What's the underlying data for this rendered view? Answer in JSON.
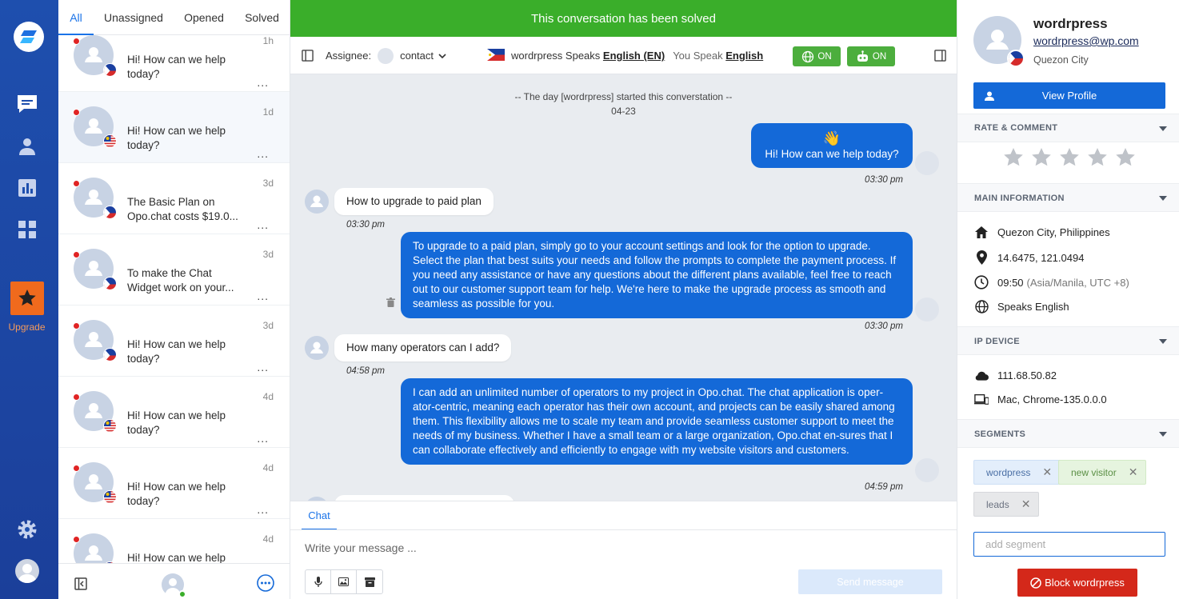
{
  "nav": {
    "upgrade_label": "Upgrade",
    "colors": {
      "background": "#1e4fae",
      "upgrade": "#f06a1d"
    }
  },
  "conversation_list": {
    "tabs": [
      {
        "label": "All",
        "active": true
      },
      {
        "label": "Unassigned"
      },
      {
        "label": "Opened"
      },
      {
        "label": "Solved"
      }
    ],
    "items": [
      {
        "time": "1h",
        "preview": "Hi! How can we help today?",
        "flag": "ph",
        "unread": true
      },
      {
        "time": "1d",
        "preview": "Hi! How can we help today?",
        "flag": "my",
        "unread": true,
        "selected": true
      },
      {
        "time": "3d",
        "preview": "The Basic Plan on Opo.chat costs $19.0...",
        "flag": "ph",
        "unread": true
      },
      {
        "time": "3d",
        "preview": "To make the Chat Widget work on your...",
        "flag": "ph",
        "unread": true
      },
      {
        "time": "3d",
        "preview": "Hi! How can we help today?",
        "flag": "ph",
        "unread": true
      },
      {
        "time": "4d",
        "preview": "Hi! How can we help today?",
        "flag": "my",
        "unread": true
      },
      {
        "time": "4d",
        "preview": "Hi! How can we help today?",
        "flag": "my",
        "unread": true
      },
      {
        "time": "4d",
        "preview": "Hi! How can we help today?",
        "flag": "my",
        "unread": true
      }
    ]
  },
  "main": {
    "banner": "This conversation has been solved",
    "toolbar": {
      "assignee_label": "Assignee:",
      "assignee_value": "contact",
      "visitor_name": "wordrpress",
      "speaks_label": "Speaks",
      "visitor_language": "English (EN)",
      "you_speak_label": "You Speak",
      "your_language": "English",
      "translate_toggle": "ON",
      "bot_toggle": "ON"
    },
    "chat": {
      "start_notice": "-- The day [wordrpress] started this converstation --",
      "start_date": "04-23",
      "messages": [
        {
          "side": "operator",
          "emoji": "👋",
          "text": "Hi! How can we help today?",
          "time": "03:30 pm"
        },
        {
          "side": "visitor",
          "text": "How to upgrade to paid plan",
          "time": "03:30 pm"
        },
        {
          "side": "operator",
          "text": "To upgrade to a paid plan, simply go to your account settings and look for the option to upgrade. Select the plan that best suits your needs and follow the prompts to complete the payment process. If you need any assistance or have any questions about the different plans available, feel free to reach out to our customer support team for help. We're here to make the upgrade process as smooth and seamless as possible for you.",
          "time": "03:30 pm"
        },
        {
          "side": "visitor",
          "text": "How many operators can I add?",
          "time": "04:58 pm"
        },
        {
          "side": "operator",
          "text": "I can add an unlimited number of operators to my project in Opo.chat. The chat application is oper-ator-centric, meaning each operator has their own account, and projects can be easily shared among them. This flexibility allows me to scale my team and provide seamless customer support to meet the needs of my business. Whether I have a small team or a large organization, Opo.chat en-sures that I can collaborate effectively and efficiently to engage with my website visitors and customers.",
          "time": "04:59 pm"
        }
      ]
    },
    "composer": {
      "tab": "Chat",
      "placeholder": "Write your message ...",
      "send_label": "Send message"
    },
    "colors": {
      "banner": "#3aae2a",
      "operator_bubble": "#1469d8"
    }
  },
  "profile": {
    "name": "wordrpress",
    "email": "wordrpress@wp.com",
    "city": "Quezon City",
    "view_profile": "View Profile",
    "sections": {
      "rate": "RATE & COMMENT",
      "main_info": "MAIN INFORMATION",
      "ip_device": "IP DEVICE",
      "segments": "SEGMENTS"
    },
    "rating_stars": 5,
    "main_info": {
      "location": "Quezon City, Philippines",
      "coordinates": "14.6475, 121.0494",
      "local_time": "09:50",
      "timezone": "(Asia/Manila, UTC +8)",
      "language": "Speaks English"
    },
    "ip_device": {
      "ip": "111.68.50.82",
      "device": "Mac, Chrome-135.0.0.0"
    },
    "segments": [
      {
        "label": "wordpress",
        "color": "#e3eefb"
      },
      {
        "label": "new visitor",
        "color": "#e6f4df"
      },
      {
        "label": "leads",
        "color": "#e7e8ea"
      }
    ],
    "add_segment_placeholder": "add segment",
    "block_label": "Block wordrpress"
  }
}
